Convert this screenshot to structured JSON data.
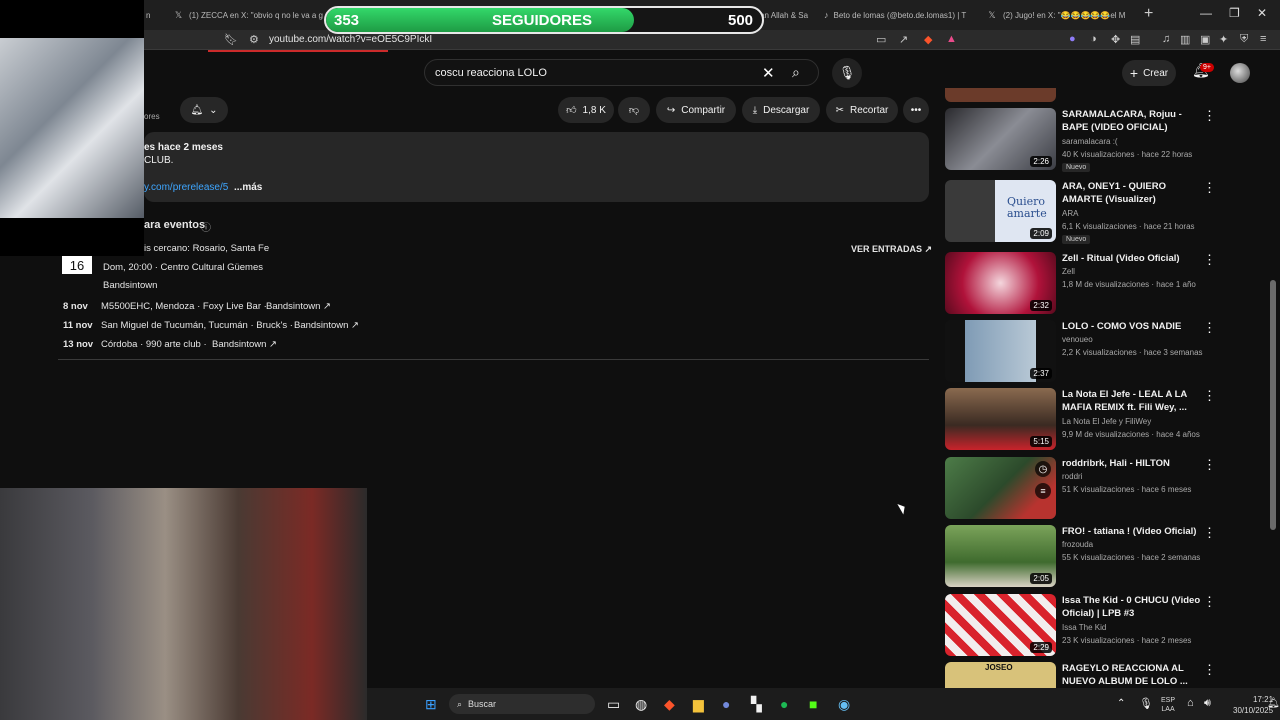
{
  "browser": {
    "tabs": [
      {
        "label": "n",
        "icon": ""
      },
      {
        "label": "(1) ZECCA en X: \"obvio q no le va a g",
        "icon": "x-icon"
      },
      {
        "label": "(58) REACCIONA N Wan Allah & Sa",
        "icon": "youtube-icon"
      },
      {
        "label": "Beto de lomas (@beto.de.lomas1) | T",
        "icon": "tiktok-icon"
      },
      {
        "label": "(2) Jugo! en X: \"😂😂😂😂😂el M",
        "icon": "x-icon"
      }
    ],
    "url": "youtube.com/watch?v=eOE5C9PIckI"
  },
  "youtube": {
    "search_query": "coscu reacciona LOLO",
    "create_label": "Crear",
    "notifications_badge": "9+",
    "actions": {
      "likes": "1,8 K",
      "share": "Compartir",
      "download": "Descargar",
      "clip": "Recortar"
    },
    "channel_sub_fragment": "ores",
    "description": {
      "line1": "es  hace 2 meses",
      "line2": "CLUB.",
      "link": "y.com/prerelease/5",
      "more": "...más"
    },
    "events": {
      "heading": "ara eventos",
      "nearest": "is cercano: Rosario, Santa Fe",
      "tickets": "VER ENTRADAS ↗",
      "featured": {
        "day": "16",
        "details": "Dom, 20:00 · Centro Cultural Güemes",
        "source": "Bandsintown"
      },
      "list": [
        {
          "date": "8 nov",
          "place": "M5500EHC, Mendoza · Foxy Live Bar  ·",
          "source": "Bandsintown ↗"
        },
        {
          "date": "11 nov",
          "place": "San Miguel de Tucumán, Tucumán · Bruck's  ·",
          "source": "Bandsintown ↗"
        },
        {
          "date": "13 nov",
          "place": "Córdoba · 990 arte club  ·",
          "source": "Bandsintown ↗"
        }
      ]
    },
    "sidebar": [
      {
        "title": "SARAMALACARA, Rojuu - BAPE (VIDEO OFICIAL)",
        "channel": "saramalacara :(",
        "meta": "40 K visualizaciones · hace 22 horas",
        "badge": "Nuevo",
        "duration": "2:26",
        "thumb": "#5a5d66"
      },
      {
        "title": "ARA, ONEY1 - QUIERO AMARTE (Visualizer)",
        "channel": "ARA",
        "meta": "6,1 K visualizaciones · hace 21 horas",
        "badge": "Nuevo",
        "duration": "2:09",
        "thumb_text": "Quiero amarte",
        "thumb": "#cfd6e6"
      },
      {
        "title": "Zell - Ritual (Video Oficial)",
        "channel": "Zell",
        "meta": "1,8 M de visualizaciones · hace 1 año",
        "badge": "",
        "duration": "2:32",
        "thumb": "#b0123a"
      },
      {
        "title": "LOLO - COMO VOS NADIE",
        "channel": "venoueo",
        "meta": "2,2 K visualizaciones · hace 3 semanas",
        "badge": "",
        "duration": "2:37",
        "thumb": "#7f9bb5"
      },
      {
        "title": "La Nota El Jefe -  LEAL A LA MAFIA REMIX ft. Fili Wey, ...",
        "channel": "La Nota El Jefe  y FiliWey",
        "meta": "9,9 M de visualizaciones · hace 4 años",
        "badge": "",
        "duration": "5:15",
        "thumb": "#6a4a3a"
      },
      {
        "title": "roddribrk, Hali - HILTON",
        "channel": "roddri",
        "meta": "51 K visualizaciones · hace 6 meses",
        "badge": "",
        "duration": "",
        "thumb": "#3d6b3a"
      },
      {
        "title": "FRO! - tatiana ! (Video Oficial)",
        "channel": "frozouda",
        "meta": "55 K visualizaciones · hace 2 semanas",
        "badge": "",
        "duration": "2:05",
        "thumb": "#4f7a3e"
      },
      {
        "title": "Issa The Kid - 0 CHUCU (Video Oficial) | LPB #3",
        "channel": "Issa The Kid",
        "meta": "23 K visualizaciones · hace 2 meses",
        "badge": "",
        "duration": "2:29",
        "thumb": "#c8323a"
      },
      {
        "title": "RAGEYLO REACCIONA AL NUEVO ALBUM DE LOLO ...",
        "channel": "",
        "meta": "",
        "badge": "",
        "duration": "",
        "thumb_text": "JOSEO",
        "thumb": "#d8c27a"
      }
    ]
  },
  "overlay": {
    "followers_current": "353",
    "followers_label": "SEGUIDORES",
    "followers_goal": "500",
    "progress": 0.706
  },
  "taskbar": {
    "search_placeholder": "Buscar",
    "lang": "ESP",
    "region": "LAA",
    "time": "17:21",
    "date": "30/10/2025"
  }
}
